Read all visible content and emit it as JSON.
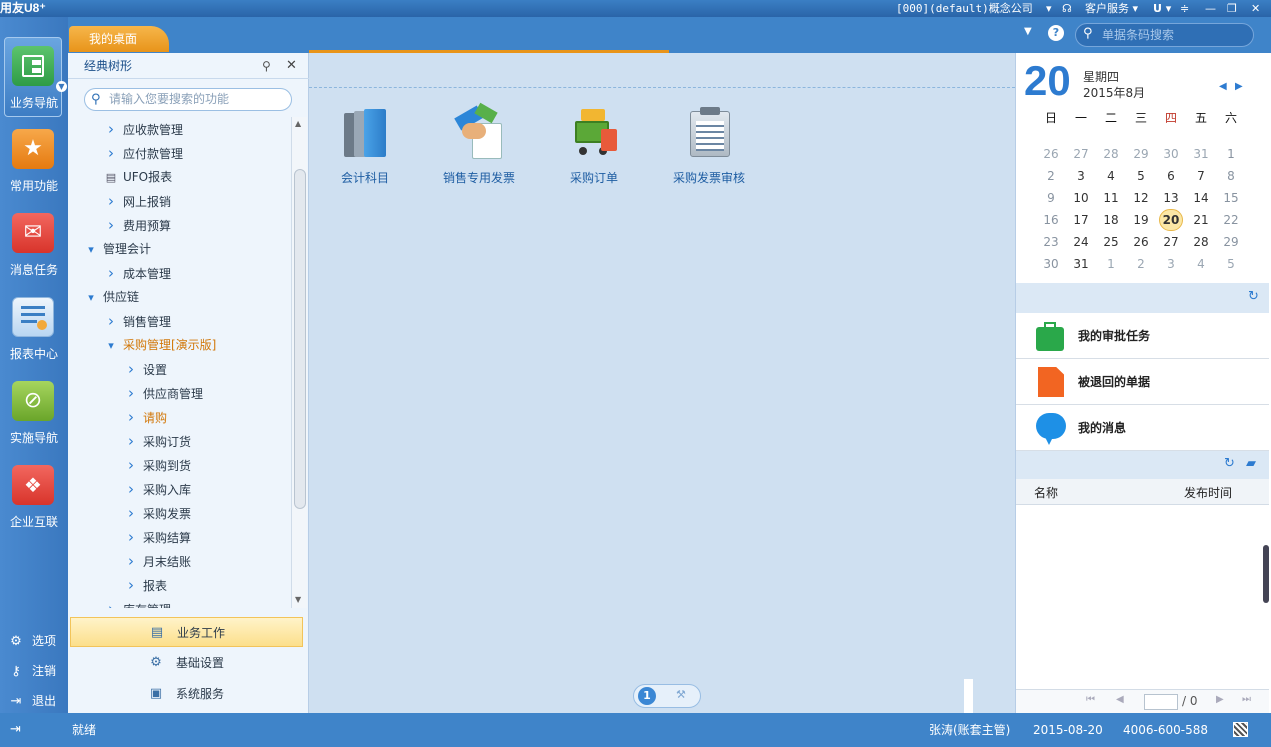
{
  "titlebar": {
    "app": "用友U8⁺",
    "company": "[000](default)概念公司",
    "service": "客户服务"
  },
  "topbar": {
    "tab": "我的桌面",
    "search_placeholder": "单据条码搜索"
  },
  "leftnav": {
    "items": [
      {
        "label": "业务导航",
        "icon": "business-nav-icon",
        "color": "#34a853"
      },
      {
        "label": "常用功能",
        "icon": "star-icon",
        "color": "#f08a24"
      },
      {
        "label": "消息任务",
        "icon": "mail-icon",
        "color": "#e8453c"
      },
      {
        "label": "报表中心",
        "icon": "report-icon",
        "color": "#4a90d9"
      },
      {
        "label": "实施导航",
        "icon": "compass-icon",
        "color": "#7cb342"
      },
      {
        "label": "企业互联",
        "icon": "connect-icon",
        "color": "#e8453c"
      }
    ],
    "bottom": [
      {
        "label": "选项",
        "icon": "gear-icon"
      },
      {
        "label": "注销",
        "icon": "key-icon"
      },
      {
        "label": "退出",
        "icon": "exit-icon"
      }
    ]
  },
  "tree": {
    "title": "经典树形",
    "search_placeholder": "请输入您要搜索的功能",
    "items": [
      {
        "label": "应收款管理",
        "level": 1,
        "state": "closed"
      },
      {
        "label": "应付款管理",
        "level": 1,
        "state": "closed"
      },
      {
        "label": "UFO报表",
        "level": 1,
        "state": "leaf"
      },
      {
        "label": "网上报销",
        "level": 1,
        "state": "closed"
      },
      {
        "label": "费用预算",
        "level": 1,
        "state": "closed"
      },
      {
        "label": "管理会计",
        "level": 0,
        "state": "open"
      },
      {
        "label": "成本管理",
        "level": 1,
        "state": "closed"
      },
      {
        "label": "供应链",
        "level": 0,
        "state": "open"
      },
      {
        "label": "销售管理",
        "level": 1,
        "state": "closed"
      },
      {
        "label": "采购管理[演示版]",
        "level": 1,
        "state": "open",
        "highlight": true
      },
      {
        "label": "设置",
        "level": 2,
        "state": "closed"
      },
      {
        "label": "供应商管理",
        "level": 2,
        "state": "closed"
      },
      {
        "label": "请购",
        "level": 2,
        "state": "closed",
        "highlight": true
      },
      {
        "label": "采购订货",
        "level": 2,
        "state": "closed"
      },
      {
        "label": "采购到货",
        "level": 2,
        "state": "closed"
      },
      {
        "label": "采购入库",
        "level": 2,
        "state": "closed"
      },
      {
        "label": "采购发票",
        "level": 2,
        "state": "closed"
      },
      {
        "label": "采购结算",
        "level": 2,
        "state": "closed"
      },
      {
        "label": "月末结账",
        "level": 2,
        "state": "closed"
      },
      {
        "label": "报表",
        "level": 2,
        "state": "closed"
      },
      {
        "label": "库存管理",
        "level": 1,
        "state": "closed"
      }
    ],
    "bottom_menu": [
      {
        "label": "业务工作",
        "active": true
      },
      {
        "label": "基础设置",
        "active": false
      },
      {
        "label": "系统服务",
        "active": false
      }
    ]
  },
  "desktop": {
    "icons": [
      {
        "label": "会计科目",
        "icon": "ledger-books-icon"
      },
      {
        "label": "销售专用发票",
        "icon": "handshake-invoice-icon"
      },
      {
        "label": "采购订单",
        "icon": "shopping-cart-icon"
      },
      {
        "label": "采购发票审核",
        "icon": "clipboard-icon"
      }
    ],
    "page": "1"
  },
  "calendar": {
    "day": "20",
    "weekday": "星期四",
    "year_month": "2015年8月",
    "headers": [
      "日",
      "一",
      "二",
      "三",
      "四",
      "五",
      "六"
    ],
    "rows": [
      [
        "26",
        "27",
        "28",
        "29",
        "30",
        "31",
        "1"
      ],
      [
        "2",
        "3",
        "4",
        "5",
        "6",
        "7",
        "8"
      ],
      [
        "9",
        "10",
        "11",
        "12",
        "13",
        "14",
        "15"
      ],
      [
        "16",
        "17",
        "18",
        "19",
        "20",
        "21",
        "22"
      ],
      [
        "23",
        "24",
        "25",
        "26",
        "27",
        "28",
        "29"
      ],
      [
        "30",
        "31",
        "1",
        "2",
        "3",
        "4",
        "5"
      ]
    ],
    "today": "20"
  },
  "tasks": [
    {
      "label": "我的审批任务",
      "icon": "briefcase-icon",
      "color": "#2aa84a"
    },
    {
      "label": "被退回的单据",
      "icon": "document-icon",
      "color": "#f26522"
    },
    {
      "label": "我的消息",
      "icon": "chat-bubble-icon",
      "color": "#1e90e6"
    }
  ],
  "notices": {
    "col_name": "名称",
    "col_time": "发布时间",
    "page_total": "/ 0"
  },
  "statusbar": {
    "status": "就绪",
    "user": "张涛(账套主管)",
    "date": "2015-08-20",
    "phone": "4006-600-588"
  }
}
